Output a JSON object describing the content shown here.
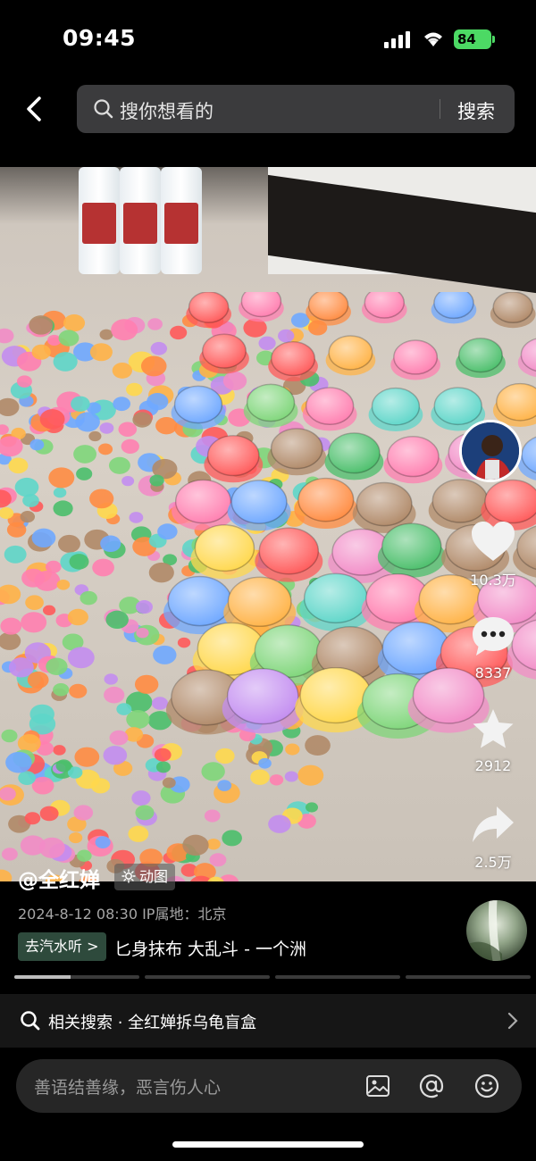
{
  "status_bar": {
    "time": "09:45",
    "battery": "84"
  },
  "top_bar": {
    "search_placeholder": "搜你想看的",
    "search_button": "搜索"
  },
  "video": {
    "image": "photo of many colorful toy turtles and glass beads on a tiled floor"
  },
  "actions": {
    "likes": "10.3万",
    "comments": "8337",
    "favorites": "2912",
    "shares": "2.5万"
  },
  "info": {
    "author": "@全红婵",
    "tag": "动图",
    "meta": "2024-8-12 08:30   IP属地：北京",
    "music_chip": "去汽水听 >",
    "music_text": "匕身抹布 大乱斗 - 一个洲"
  },
  "progress": {
    "segments": 4,
    "filled_fraction": 0.45
  },
  "related": {
    "text": "相关搜索 · 全红婵拆乌龟盲盒"
  },
  "comment": {
    "placeholder": "善语结善缘，恶言伤人心"
  },
  "colors": {
    "battery": "#4cd964",
    "music_chip": "#2e4a3c",
    "background": "#000000"
  }
}
